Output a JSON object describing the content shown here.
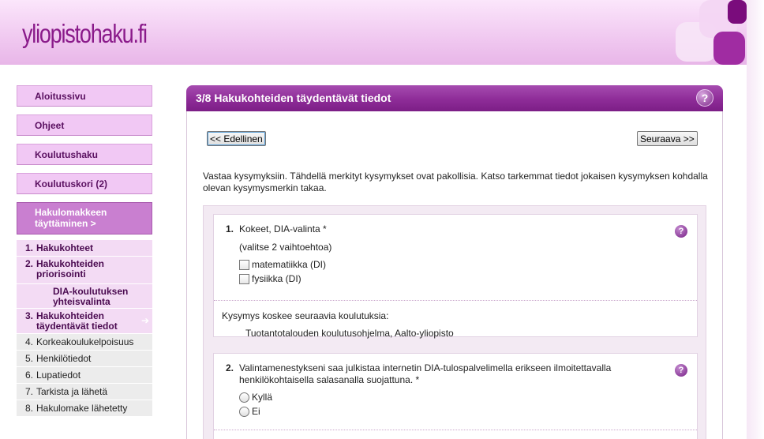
{
  "site": {
    "logo_text": "yliopistohaku.fi"
  },
  "sidebar": {
    "nav": [
      {
        "label": "Aloitussivu"
      },
      {
        "label": "Ohjeet"
      },
      {
        "label": "Koulutushaku"
      },
      {
        "label": "Koulutuskori (2)"
      }
    ],
    "active_section": "Hakulomakkeen täyttäminen >",
    "steps": [
      {
        "num": "1.",
        "label": "Hakukohteet"
      },
      {
        "num": "2.",
        "label": "Hakukohteiden priorisointi"
      },
      {
        "num": "",
        "label": "DIA-koulutuksen yhteisvalinta"
      },
      {
        "num": "3.",
        "label": "Hakukohteiden täydentävät tiedot",
        "arrow": "➔"
      },
      {
        "num": "4.",
        "label": "Korkeakoulukelpoisuus"
      },
      {
        "num": "5.",
        "label": "Henkilötiedot"
      },
      {
        "num": "6.",
        "label": "Lupatiedot"
      },
      {
        "num": "7.",
        "label": "Tarkista ja lähetä"
      },
      {
        "num": "8.",
        "label": "Hakulomake lähetetty"
      }
    ]
  },
  "main": {
    "title": "3/8 Hakukohteiden täydentävät tiedot",
    "help_icon": "?",
    "prev_label": "<< Edellinen",
    "next_label": "Seuraava >>",
    "intro": "Vastaa kysymyksiin. Tähdellä merkityt kysymykset ovat pakollisia. Katso tarkemmat tiedot jokaisen kysymyksen kohdalla olevan kysymysmerkin takaa.",
    "questions": [
      {
        "num": "1.",
        "text": "Kokeet, DIA-valinta  *",
        "hint": "(valitse  2  vaihtoehtoa)",
        "options": [
          "matematiikka (DI)",
          "fysiikka (DI)"
        ],
        "applies_label": "Kysymys koskee seuraavia koulutuksia:",
        "applies_item": "Tuotantotalouden koulutusohjelma, Aalto-yliopisto"
      },
      {
        "num": "2.",
        "text_line1": "Valintamenestykseni saa julkistaa internetin DIA-tulospalvelimella erikseen ilmoitettavalla",
        "text_line2": "henkilökohtaisella salasanalla suojattuna.  *",
        "options": [
          "Kyllä",
          "Ei"
        ]
      }
    ]
  },
  "colors": {
    "accent": "#8e2c98",
    "nav_bg": "#f1c8f4",
    "active_bg": "#c97fd0"
  }
}
